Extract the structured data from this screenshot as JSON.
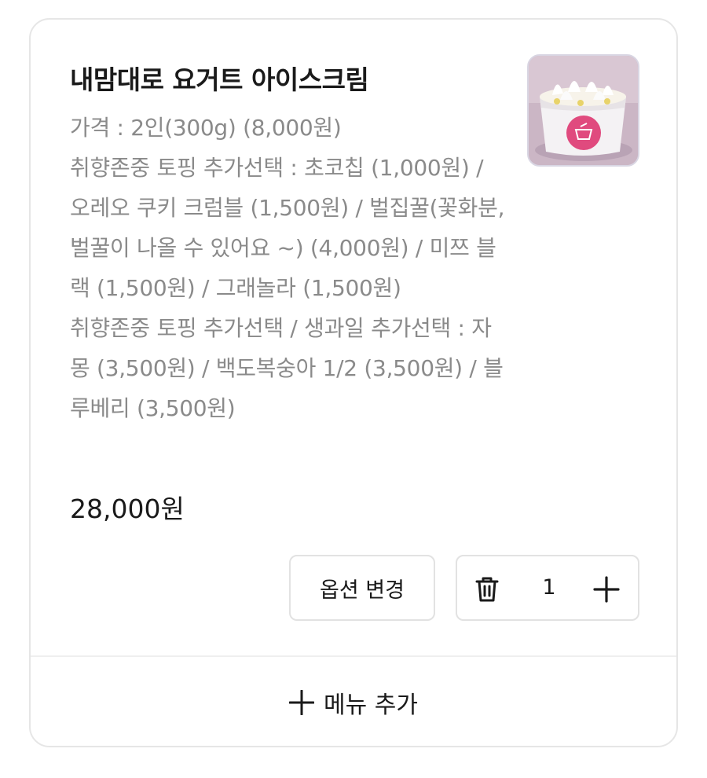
{
  "item": {
    "title": "내맘대로 요거트 아이스크림",
    "thumbnail_icon": "yogurt-ice-cream-cup-image",
    "options": [
      "가격 : 2인(300g) (8,000원)",
      "취향존중 토핑 추가선택 : 초코칩 (1,000원) / 오레오 쿠키 크럼블 (1,500원) / 벌집꿀(꽃화분, 벌꿀이 나올 수 있어요 ~) (4,000원) / 미쯔 블랙 (1,500원) / 그래놀라 (1,500원)",
      "취향존중 토핑 추가선택 / 생과일 추가선택 : 자몽 (3,500원) / 백도복숭아 1/2 (3,500원) / 블루베리 (3,500원)"
    ],
    "total_price": "28,000원"
  },
  "actions": {
    "change_option_label": "옵션 변경",
    "quantity": "1",
    "delete_icon": "trash-icon",
    "increase_icon": "plus-icon"
  },
  "footer": {
    "add_menu_label": "메뉴 추가",
    "add_menu_icon": "plus-icon"
  },
  "colors": {
    "text_primary": "#1a1a1a",
    "text_secondary": "#8a8a8a",
    "border": "#e2e2e2",
    "badge_pink": "#e04a7e"
  }
}
